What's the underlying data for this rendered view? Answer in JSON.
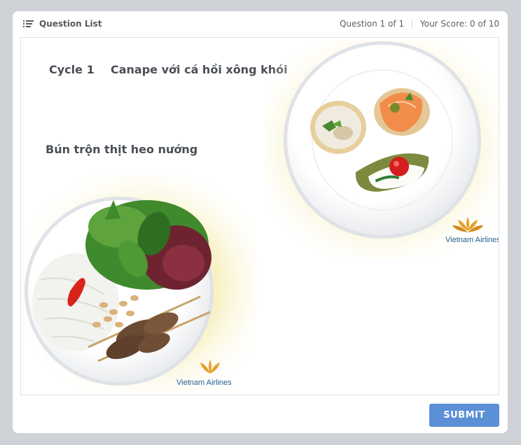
{
  "toolbar": {
    "question_list_label": "Question List",
    "question_counter": "Question 1 of 1",
    "score": "Your Score: 0 of 10"
  },
  "question": {
    "cycle_label": "Cycle 1",
    "drag_item_top": "Canape với cá hồi xông khói",
    "drag_item_bottom": "Bún trộn thịt heo nướng",
    "images": [
      {
        "icon": "canape-plate-image",
        "brand": "Vietnam Airlines"
      },
      {
        "icon": "noodle-salad-plate-image",
        "brand": "Vietnam Airlines"
      }
    ]
  },
  "footer": {
    "submit_label": "SUBMIT"
  },
  "colors": {
    "page_bg": "#cfd2d6",
    "card_bg": "#ffffff",
    "accent_button": "#5b8fd6",
    "text": "#4a4f55"
  }
}
